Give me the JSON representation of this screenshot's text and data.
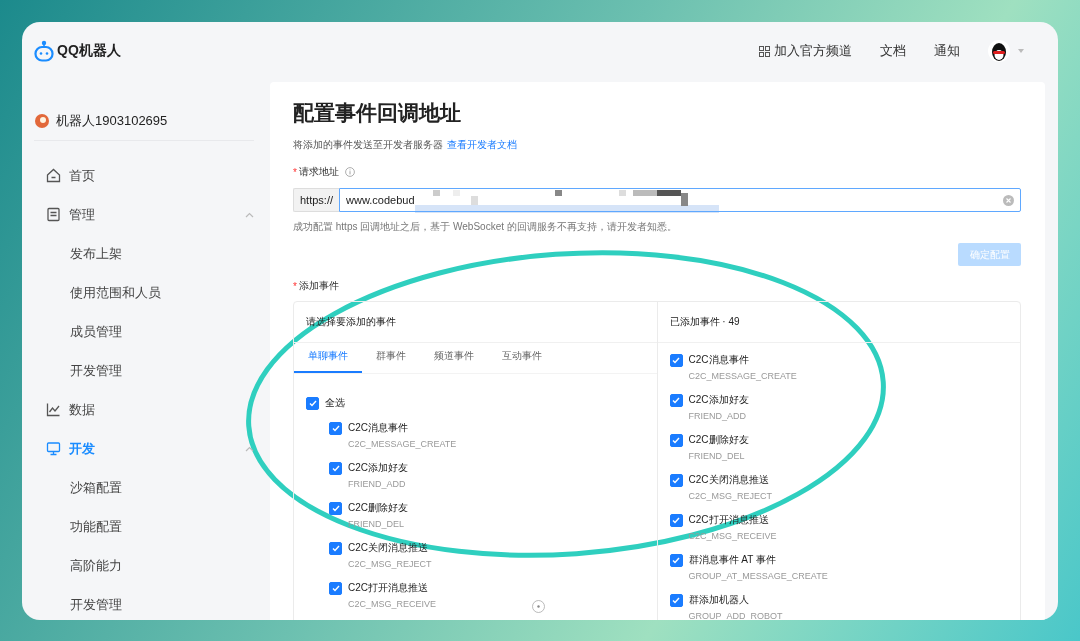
{
  "header": {
    "logo_text": "QQ机器人",
    "nav": [
      {
        "label": "加入官方频道",
        "kind": "grid"
      },
      {
        "label": "文档",
        "kind": "plain"
      },
      {
        "label": "通知",
        "kind": "plain"
      }
    ]
  },
  "sidebar": {
    "bot_name": "机器人1903102695",
    "items": [
      {
        "label": "首页",
        "kind": "home",
        "selected": false
      },
      {
        "label": "管理",
        "kind": "doc",
        "selected": false,
        "expanded": true,
        "children": [
          {
            "label": "发布上架",
            "selected": false
          },
          {
            "label": "使用范围和人员",
            "selected": false
          },
          {
            "label": "成员管理",
            "selected": false
          },
          {
            "label": "开发管理",
            "selected": false
          }
        ]
      },
      {
        "label": "数据",
        "kind": "chart",
        "selected": false
      },
      {
        "label": "开发",
        "kind": "monitor",
        "selected": true,
        "expanded": true,
        "children": [
          {
            "label": "沙箱配置",
            "selected": false
          },
          {
            "label": "功能配置",
            "selected": false
          },
          {
            "label": "高阶能力",
            "selected": false
          },
          {
            "label": "开发管理",
            "selected": false
          }
        ]
      }
    ]
  },
  "content": {
    "title": "配置事件回调地址",
    "description": "将添加的事件发送至开发者服务器",
    "doc_link": "查看开发者文档",
    "url_field": {
      "label": "请求地址",
      "required_mark": "*",
      "prefix": "https://",
      "value": "www.codebud",
      "hint": "成功配置 https 回调地址之后，基于 WebSocket 的回调服务不再支持，请开发者知悉。"
    },
    "confirm_button": {
      "label": "确定配置",
      "disabled": true
    },
    "events": {
      "label": "添加事件",
      "required_mark": "*",
      "picker_title": "请选择要添加的事件",
      "added_title": "已添加事件 · 49",
      "tabs": [
        {
          "label": "单聊事件",
          "selected": true
        },
        {
          "label": "群事件",
          "selected": false
        },
        {
          "label": "频道事件",
          "selected": false
        },
        {
          "label": "互动事件",
          "selected": false
        }
      ],
      "select_all": {
        "label": "全选",
        "checked": true
      },
      "available": [
        {
          "name": "C2C消息事件",
          "code": "C2C_MESSAGE_CREATE",
          "checked": true
        },
        {
          "name": "C2C添加好友",
          "code": "FRIEND_ADD",
          "checked": true
        },
        {
          "name": "C2C删除好友",
          "code": "FRIEND_DEL",
          "checked": true
        },
        {
          "name": "C2C关闭消息推送",
          "code": "C2C_MSG_REJECT",
          "checked": true
        },
        {
          "name": "C2C打开消息推送",
          "code": "C2C_MSG_RECEIVE",
          "checked": true
        }
      ],
      "added": [
        {
          "name": "C2C消息事件",
          "code": "C2C_MESSAGE_CREATE",
          "checked": true
        },
        {
          "name": "C2C添加好友",
          "code": "FRIEND_ADD",
          "checked": true
        },
        {
          "name": "C2C删除好友",
          "code": "FRIEND_DEL",
          "checked": true
        },
        {
          "name": "C2C关闭消息推送",
          "code": "C2C_MSG_REJECT",
          "checked": true
        },
        {
          "name": "C2C打开消息推送",
          "code": "C2C_MSG_RECEIVE",
          "checked": true
        },
        {
          "name": "群消息事件 AT 事件",
          "code": "GROUP_AT_MESSAGE_CREATE",
          "checked": true
        },
        {
          "name": "群添加机器人",
          "code": "GROUP_ADD_ROBOT",
          "checked": true
        }
      ]
    }
  }
}
